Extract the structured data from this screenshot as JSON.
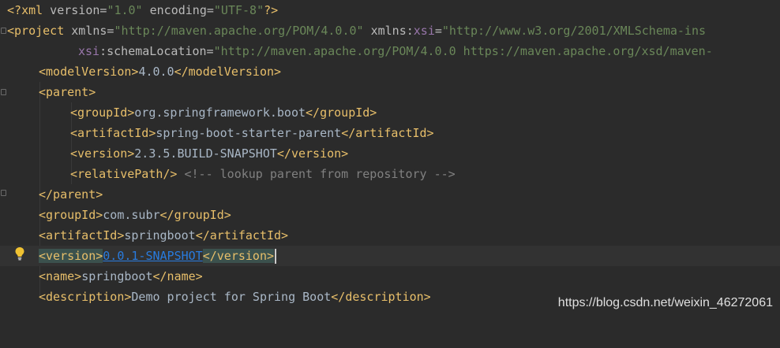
{
  "lines": {
    "l1": {
      "open": "<?",
      "name": "xml",
      "a1": " version=",
      "v1": "\"1.0\"",
      "a2": " encoding=",
      "v2": "\"UTF-8\"",
      "close": "?>"
    },
    "l2": {
      "lt": "<",
      "tag": "project",
      "a1": " xmlns=",
      "v1": "\"http://maven.apache.org/POM/4.0.0\"",
      "a2pre": " xmlns:",
      "ns": "xsi",
      "eq": "=",
      "v2": "\"http://www.w3.org/2001/XMLSchema-ins"
    },
    "l3": {
      "ns": "xsi",
      "a": ":schemaLocation=",
      "v": "\"http://maven.apache.org/POM/4.0.0 https://maven.apache.org/xsd/maven-"
    },
    "l4": {
      "open": "<modelVersion>",
      "text": "4.0.0",
      "close": "</modelVersion>"
    },
    "l5": {
      "open": "<parent>"
    },
    "l6": {
      "open": "<groupId>",
      "text": "org.springframework.boot",
      "close": "</groupId>"
    },
    "l7": {
      "open": "<artifactId>",
      "text": "spring-boot-starter-parent",
      "close": "</artifactId>"
    },
    "l8": {
      "open": "<version>",
      "text": "2.3.5.BUILD-SNAPSHOT",
      "close": "</version>"
    },
    "l9": {
      "open": "<relativePath/>",
      "comment": " <!-- lookup parent from repository -->"
    },
    "l10": {
      "close": "</parent>"
    },
    "l11": {
      "open": "<groupId>",
      "text": "com.subr",
      "close": "</groupId>"
    },
    "l12": {
      "open": "<artifactId>",
      "text": "springboot",
      "close": "</artifactId>"
    },
    "l13": {
      "open": "<version>",
      "text": "0.0.1-SNAPSHOT",
      "close": "</version>"
    },
    "l14": {
      "open": "<name>",
      "text": "springboot",
      "close": "</name>"
    },
    "l15": {
      "open": "<description>",
      "text": "Demo project for Spring Boot",
      "close": "</description>"
    }
  },
  "watermark": "https://blog.csdn.net/weixin_46272061",
  "colors": {
    "background": "#2b2b2b",
    "tag": "#e8bf6a",
    "string": "#6a8759",
    "comment": "#808080",
    "link": "#287bde",
    "text": "#a9b7c6"
  },
  "icons": {
    "intention": "lightbulb-icon",
    "fold": "fold-marker-icon"
  }
}
